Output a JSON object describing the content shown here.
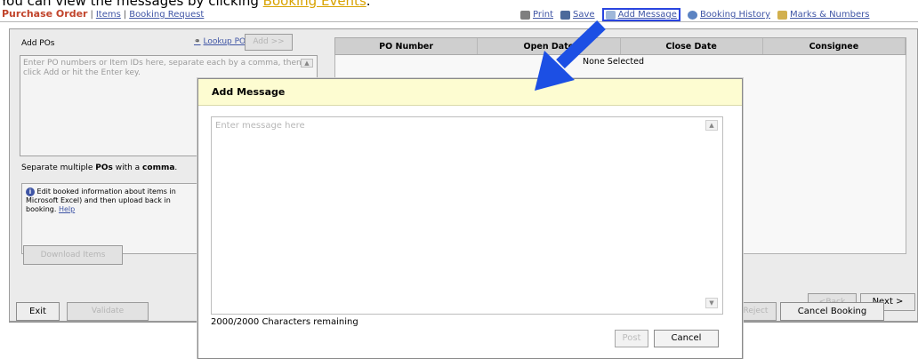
{
  "caption": {
    "prefix": "You can view the messages by clicking ",
    "link": "Booking Events",
    "suffix": "."
  },
  "topbar": {
    "purchase_order": "Purchase Order",
    "items": "Items",
    "booking_request": "Booking Request",
    "print": "Print",
    "save": "Save",
    "add_message": "Add Message",
    "booking_history": "Booking History",
    "marks_numbers": "Marks & Numbers"
  },
  "left_panel": {
    "add_pos_label": "Add POs",
    "lookup_pos": "Lookup POs",
    "add_button": "Add >>",
    "po_input_placeholder": "Enter PO numbers or Item IDs here, separate each by a comma, then click Add or hit the Enter key.",
    "separate_note_prefix": "Separate multiple ",
    "separate_note_bold1": "POs",
    "separate_note_mid": " with a ",
    "separate_note_bold2": "comma",
    "separate_note_suffix": ".",
    "info_text": "Edit booked information about items in Microsoft Excel) and then upload back in booking.",
    "help": "Help",
    "download_items": "Download Items"
  },
  "table": {
    "headers": [
      "PO Number",
      "Open Date",
      "Close Date",
      "Consignee"
    ],
    "empty_text": "None Selected"
  },
  "nav": {
    "back": "<Back",
    "next": "Next >"
  },
  "bottom": {
    "exit": "Exit",
    "validate": "Validate",
    "reject": "Reject",
    "cancel_booking": "Cancel Booking"
  },
  "modal": {
    "title": "Add Message",
    "placeholder": "Enter message here",
    "remaining": "2000/2000 Characters remaining",
    "post": "Post",
    "cancel": "Cancel"
  },
  "colors": {
    "link": "#3f55a5",
    "purchase_order": "#c1442b",
    "caption_link": "#d8a200",
    "arrow": "#1c4fe4",
    "modal_title_bg": "#fdfcd1"
  }
}
